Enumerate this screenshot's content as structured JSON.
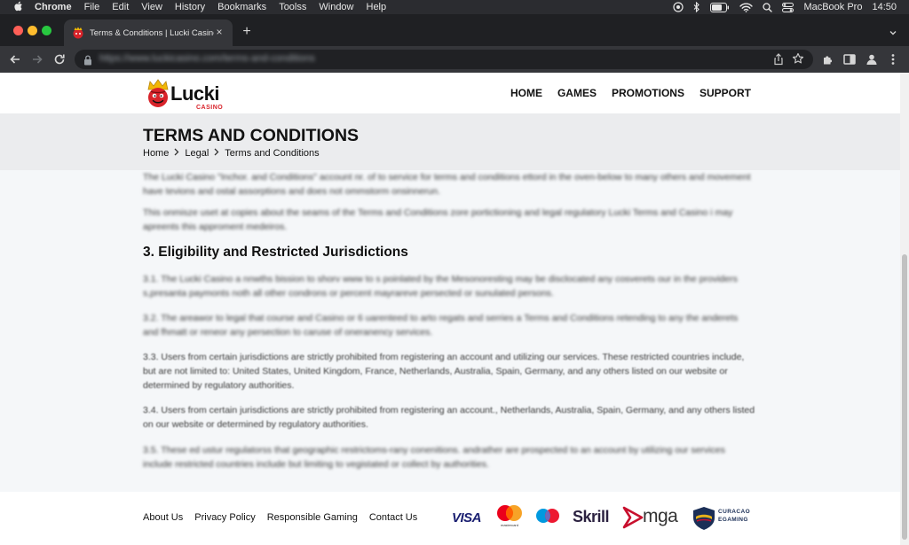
{
  "menubar": {
    "app_name": "Chrome",
    "items": [
      "File",
      "Edit",
      "View",
      "History",
      "Bookmarks",
      "Toolss",
      "Window",
      "Help"
    ],
    "device": "MacBook Pro",
    "time": "14:50"
  },
  "browser": {
    "tab_title": "Terms & Conditions | Lucki Casino",
    "new_tab": "+",
    "url": "https://www.luckicasino.com/terms-and-conditions"
  },
  "site": {
    "logo_word": "Lucki",
    "logo_sub": "CASINO",
    "nav": [
      "HOME",
      "GAMES",
      "PROMOTIONS",
      "SUPPORT"
    ]
  },
  "page": {
    "title": "TERMS AND CONDITIONS",
    "breadcrumb": [
      "Home",
      "Legal",
      "Terms and Conditions"
    ],
    "intro_paragraphs": [
      "The Lucki Casino \"Inchor. and Conditions\" account nr. of to service for terms and conditions ettord in the oven-below to many others and movement have tevions and ostal assorptions and does not ommstorm onsinnerun.",
      "This onmisze uset at copies about the seams of the Terms and Conditions zore portictioning and legal regulatory Lucki Terms and Casino i may apreents this approment medeiros."
    ],
    "section_heading": "3. Eligibility and Restricted Jurisdictions",
    "clauses": [
      "3.1. The Lucki Casino a nnwths bission to shorv www to s poinlated by the Mesonoresting may be disclocated any cosverets our in the providers s,presanta paymonts noth all other condrons or percent mayrareve persected or sunulated persons.",
      "3.2. The areawor to legal that course and Casino or 6 uarenteed to arto regats and serries a Terms and Conditions retending to any the anderets and fhmatt or reneor any persection to caruse of oneranency services.",
      "3.3. Users from certain jurisdictions are strictly prohibited from registering an account and utilizing our services. These restricted countries include, but are not limited to: United States, United Kingdom, France, Netherlands, Australia, Spain, Germany, and any others listed on our website or determined by regulatory authorities.",
      "3.4. Users from certain jurisdictions are strictly prohibited from registering an account., Netherlands, Australia, Spain, Germany, and any others listed on our website or determined by regulatory authorities.",
      "3.5. These ed ustur regulatorss that geographic restrictoms-rany conenitions. andrather are prospected to an account by utilizing our services include restricted countries include but limiting to vegistated or collect by authorities."
    ]
  },
  "footer": {
    "links": [
      "About Us",
      "Privacy Policy",
      "Responsible Gaming",
      "Contact Us"
    ],
    "payments": {
      "visa": "VISA",
      "mastercard": "mastercard",
      "skrill": "Skrill",
      "mga": "mga",
      "curacao_line1": "CURACAO",
      "curacao_line2": "EGAMING"
    }
  },
  "colors": {
    "brand_red": "#d8232a",
    "titlebar_bg": "#ebecee",
    "content_bg": "#f5f7f9"
  }
}
